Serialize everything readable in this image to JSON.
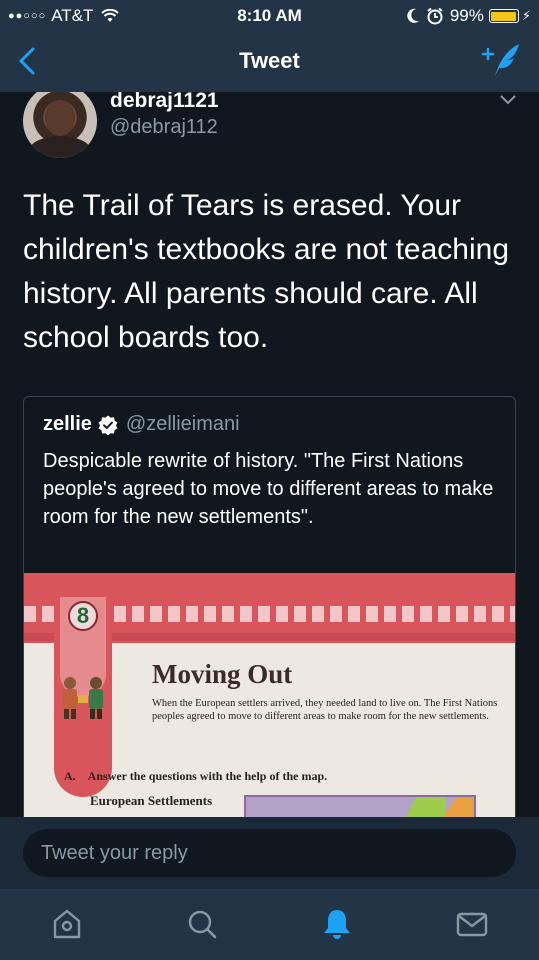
{
  "status_bar": {
    "carrier": "AT&T",
    "time": "8:10 AM",
    "battery": "99%",
    "battery_level": 0.99,
    "signal_dots": "●●○○○"
  },
  "nav": {
    "title": "Tweet",
    "back_icon": "chevron-left-icon",
    "compose_icon": "compose-tweet-icon"
  },
  "tweet": {
    "display_name": "debraj1121",
    "handle": "@debraj112",
    "text": "The Trail of Tears is erased. Your children's textbooks are not teaching history. All parents should care. All school boards too."
  },
  "quoted_tweet": {
    "display_name": "zellie",
    "handle": "@zellieimani",
    "verified": true,
    "text": "Despicable rewrite of history. \"The First Nations people's agreed to move to different areas to make room for the new settlements\".",
    "image": {
      "chapter_number": "8",
      "title": "Moving Out",
      "body": "When the European settlers arrived, they needed land to live on. The First Nations peoples agreed to move to different areas to make room for the new settlements.",
      "question_letter": "A.",
      "question": "Answer the questions with the help of the map.",
      "subheading": "European Settlements"
    }
  },
  "reply": {
    "placeholder": "Tweet your reply"
  },
  "tab_bar": {
    "active_color": "#1da1f2",
    "inactive_color": "#8899a6",
    "icons": [
      "home-icon",
      "search-icon",
      "notifications-icon",
      "messages-icon"
    ]
  },
  "colors": {
    "background": "#10171e",
    "bar": "#243447",
    "accent": "#1da1f2",
    "muted": "#8899a6"
  }
}
